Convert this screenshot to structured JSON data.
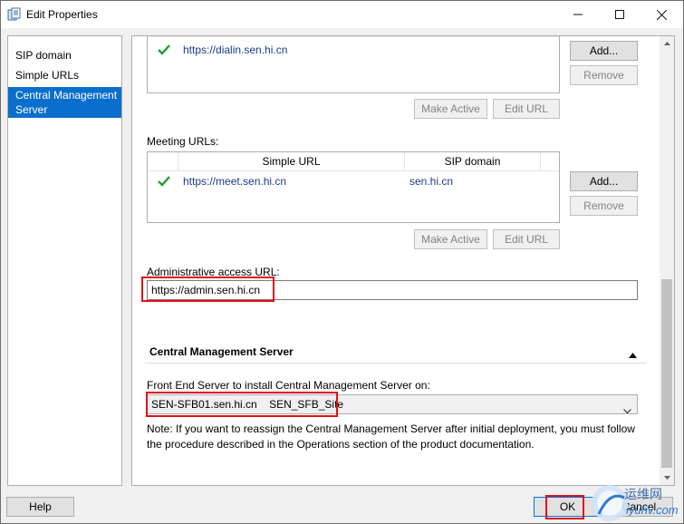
{
  "window": {
    "title": "Edit Properties"
  },
  "nav": {
    "items": [
      {
        "label": "SIP domain"
      },
      {
        "label": "Simple URLs"
      },
      {
        "label": "Central Management Server"
      }
    ]
  },
  "dialin": {
    "url": "https://dialin.sen.hi.cn",
    "add_label": "Add...",
    "remove_label": "Remove",
    "make_active_label": "Make Active",
    "edit_url_label": "Edit URL"
  },
  "meeting": {
    "section_label": "Meeting URLs:",
    "columns": [
      "Simple URL",
      "SIP domain"
    ],
    "rows": [
      {
        "url": "https://meet.sen.hi.cn",
        "sip_domain": "sen.hi.cn"
      }
    ],
    "add_label": "Add...",
    "remove_label": "Remove",
    "make_active_label": "Make Active",
    "edit_url_label": "Edit URL"
  },
  "admin": {
    "label": "Administrative access URL:",
    "value": "https://admin.sen.hi.cn"
  },
  "cms": {
    "section_title": "Central Management Server",
    "front_end_label": "Front End Server to install Central Management Server on:",
    "selected_server": "SEN-SFB01.sen.hi.cn",
    "selected_site": "SEN_SFB_Site",
    "note_line1": "Note: If you want to reassign the Central Management Server after initial deployment, you must follow",
    "note_line2": "the procedure described in the Operations section of the product documentation."
  },
  "footer": {
    "help_label": "Help",
    "ok_label": "OK",
    "cancel_label": "Cancel"
  },
  "watermark": {
    "text_cn": "运维网",
    "text_en": "iyunv.com"
  },
  "colors": {
    "selection": "#0a6fcc",
    "highlight_box": "#e0101a",
    "check": "#1fa12f",
    "link": "#1a3a8a"
  }
}
